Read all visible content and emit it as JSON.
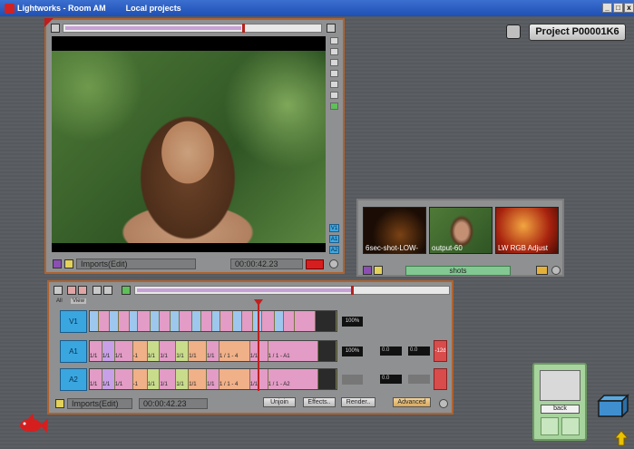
{
  "window": {
    "title": "Lightworks - Room AM",
    "menu": "Local projects",
    "controls": [
      "_",
      "□",
      "x"
    ]
  },
  "project": {
    "label": "Project P00001K6"
  },
  "viewer": {
    "name": "Imports(Edit)",
    "timecode": "00:00:42.23"
  },
  "bin": {
    "title": "shots",
    "thumbs": [
      "6sec-shot-LOW-",
      "output-60",
      "LW RGB Adjust"
    ]
  },
  "timeline": {
    "name": "Imports(Edit)",
    "timecode": "00:00:42.23",
    "tracks": [
      {
        "label": "V1",
        "level": "100%"
      },
      {
        "label": "A1",
        "level": "100%",
        "val1": "0.0",
        "val2": "0.0",
        "db": "-12d"
      },
      {
        "label": "A2",
        "level": "",
        "val1": "0.0",
        "db": "-12d"
      }
    ],
    "buttons": {
      "unjoin": "Unjoin",
      "effects": "Effects..",
      "render": "Render..",
      "advanced": "Advanced"
    },
    "top_labels": {
      "all": "All",
      "view": "View"
    },
    "a1_clips": "1 / 1 - 4",
    "a1_tail": "1 / 1 - A1",
    "a2_tail": "1 / 1 - A2"
  },
  "toolbox": {
    "back": "back"
  },
  "colors": {
    "accent": "#b0622e",
    "video_track": "#3aa6e0",
    "bin_bar": "#83c893",
    "record": "#d71e1e"
  }
}
